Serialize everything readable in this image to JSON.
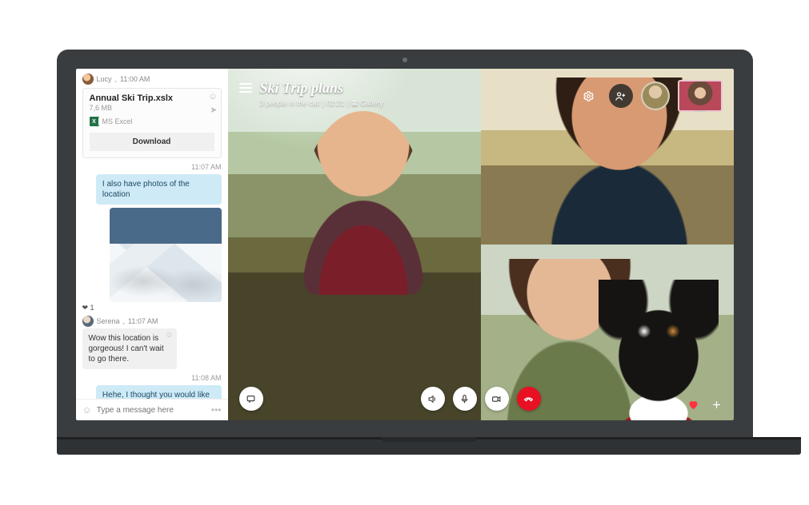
{
  "chat": {
    "sender1": {
      "name": "Lucy",
      "time": "11:00 AM"
    },
    "file": {
      "title": "Annual Ski Trip.xslx",
      "size": "7,6 MB",
      "type_label": "MS Excel",
      "excel_glyph": "X",
      "download_label": "Download"
    },
    "ts1": "11:07 AM",
    "msg1": "I also have photos of the location",
    "reaction": "❤ 1",
    "sender2": {
      "name": "Serena",
      "time": "11:07 AM"
    },
    "msg2": "Wow this location is gorgeous! I can't wait to go there.",
    "ts2": "11:08 AM",
    "msg3": "Hehe, I thought you would like it.",
    "composer_placeholder": "Type a message here",
    "more_glyph": "•••"
  },
  "call": {
    "title": "Ski Trip plans",
    "sub_people": "3 people in the call",
    "sub_time": "02:21",
    "sub_gallery": "Gallery",
    "sep": "|"
  }
}
